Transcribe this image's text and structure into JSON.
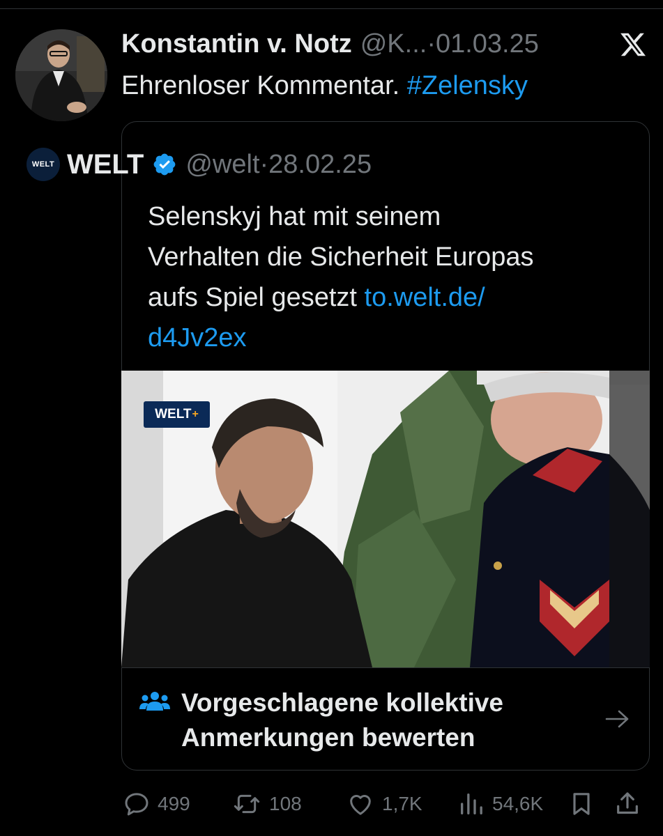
{
  "tweet": {
    "author_name": "Konstantin v. Notz",
    "author_handle": "@K...",
    "separator": "·",
    "date": "01.03.25",
    "text_plain": "Ehrenloser Kommentar.",
    "hashtag": "#Zelensky",
    "avatar_icon": "profile-photo",
    "platform_icon": "x-logo-icon"
  },
  "quote": {
    "avatar_text": "WELT",
    "name": "WELT",
    "verified_icon": "verified-badge-icon",
    "handle": "@welt",
    "separator": "·",
    "date": "28.02.25",
    "text_lines": [
      "Selenskyj hat mit seinem",
      "Verhalten die Sicherheit Europas"
    ],
    "text_line3_plain": "aufs Spiel gesetzt",
    "link_part1": "to.welt.de/",
    "link_part2": "d4Jv2ex",
    "media_badge_text": "WELT",
    "media_badge_plus": "+"
  },
  "community_notes": {
    "icon": "people-icon",
    "line1": "Vorgeschlagene kollektive",
    "line2": "Anmerkungen bewerten",
    "arrow_icon": "arrow-right-icon"
  },
  "actions": {
    "reply_count": "499",
    "retweet_count": "108",
    "like_count": "1,7K",
    "views_count": "54,6K"
  },
  "colors": {
    "background": "#000000",
    "text": "#e7e9ea",
    "muted": "#71767b",
    "link": "#1d9bf0",
    "border": "#2f3336",
    "welt_navy": "#0b2a57"
  }
}
